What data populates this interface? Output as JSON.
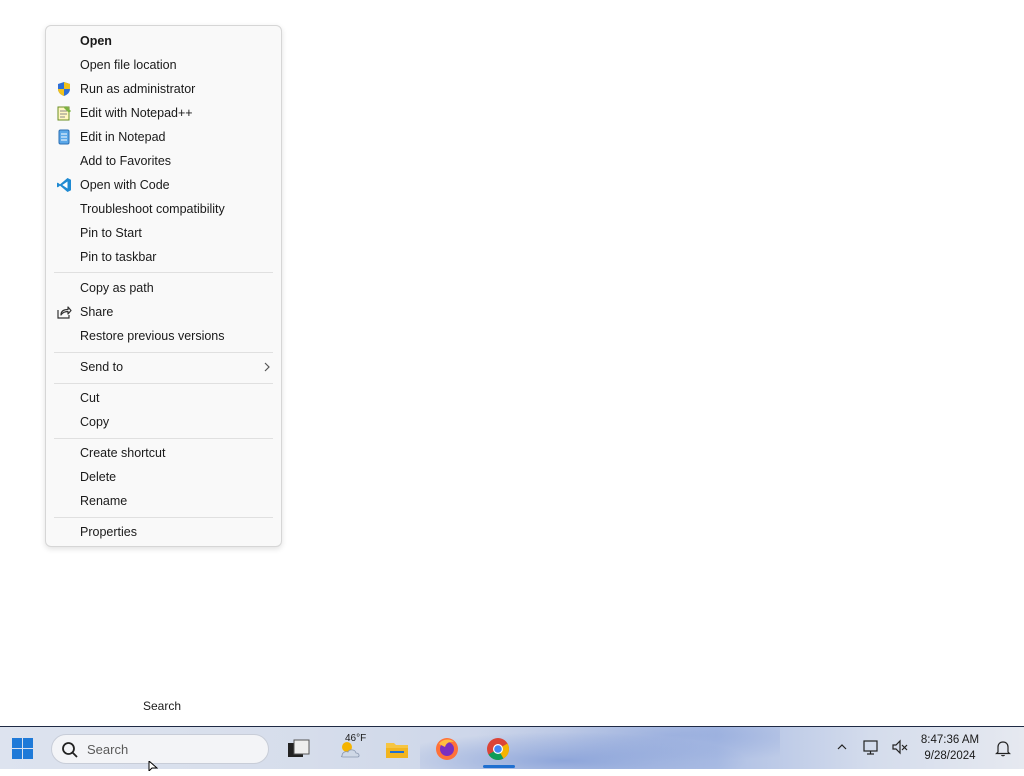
{
  "context_menu": {
    "items": [
      {
        "label": "Open",
        "icon": "",
        "bold": true
      },
      {
        "label": "Open file location",
        "icon": ""
      },
      {
        "label": "Run as administrator",
        "icon": "uac-shield-icon"
      },
      {
        "label": "Edit with Notepad++",
        "icon": "notepad-plus-plus-icon"
      },
      {
        "label": "Edit in Notepad",
        "icon": "notepad-icon"
      },
      {
        "label": "Add to Favorites",
        "icon": ""
      },
      {
        "label": "Open with Code",
        "icon": "vscode-icon"
      },
      {
        "label": "Troubleshoot compatibility",
        "icon": ""
      },
      {
        "label": "Pin to Start",
        "icon": ""
      },
      {
        "label": "Pin to taskbar",
        "icon": ""
      },
      {
        "label": "Copy as path",
        "icon": ""
      },
      {
        "label": "Share",
        "icon": "share-icon"
      },
      {
        "label": "Restore previous versions",
        "icon": ""
      },
      {
        "label": "Send to",
        "icon": "",
        "submenu": true
      },
      {
        "label": "Cut",
        "icon": ""
      },
      {
        "label": "Copy",
        "icon": ""
      },
      {
        "label": "Create shortcut",
        "icon": ""
      },
      {
        "label": "Delete",
        "icon": ""
      },
      {
        "label": "Rename",
        "icon": ""
      },
      {
        "label": "Properties",
        "icon": ""
      }
    ]
  },
  "tooltip": {
    "text": "Search"
  },
  "taskbar": {
    "search_placeholder": "Search",
    "weather_temp": "46°F",
    "clock_time": "8:47:36 AM",
    "clock_date": "9/28/2024",
    "accent": "#1f6fd0"
  }
}
